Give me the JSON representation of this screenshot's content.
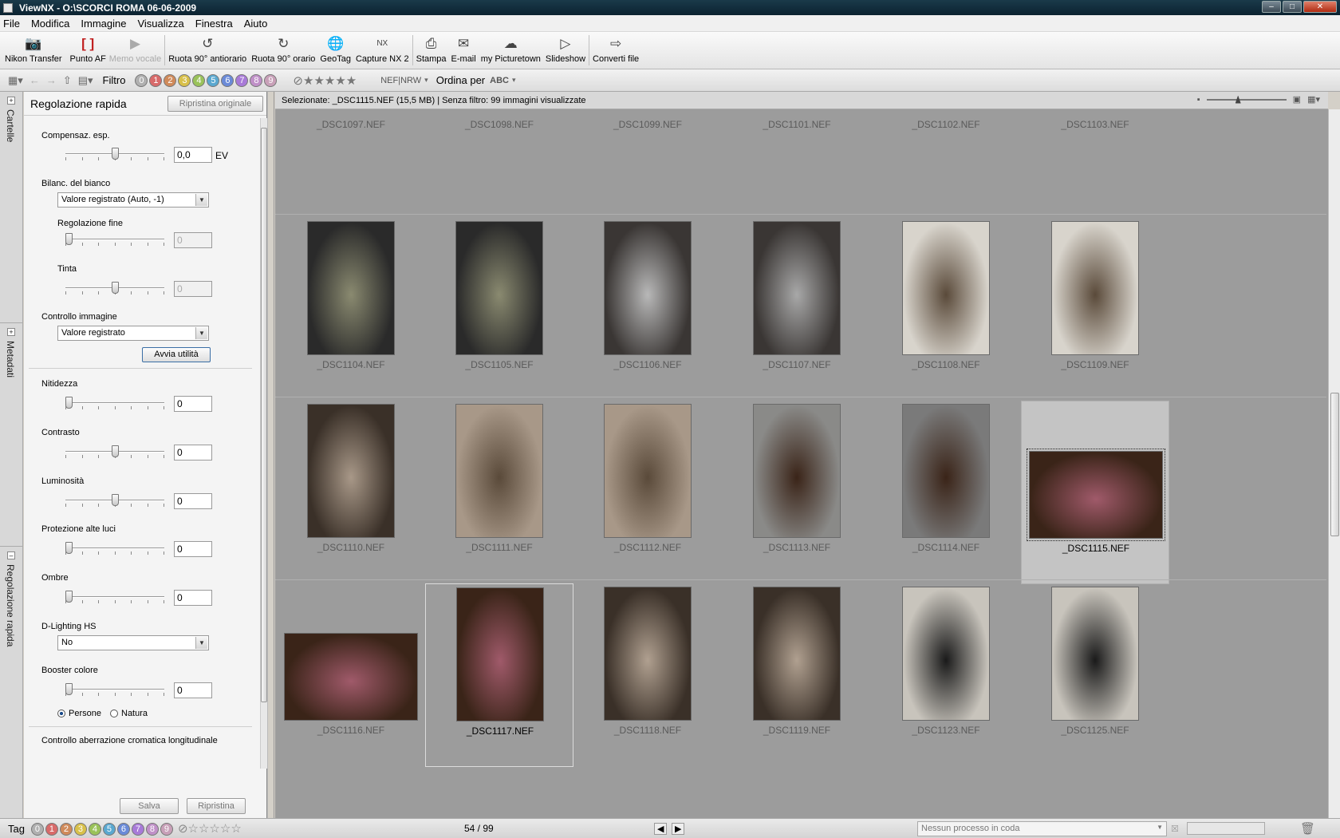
{
  "window": {
    "app": "ViewNX",
    "title": "ViewNX - O:\\SCORCI ROMA 06-06-2009"
  },
  "menu": [
    "File",
    "Modifica",
    "Immagine",
    "Visualizza",
    "Finestra",
    "Aiuto"
  ],
  "toolbar": {
    "items": [
      {
        "label": "Nikon Transfer",
        "icon": "camera-icon"
      },
      {
        "label": "Punto AF",
        "icon": "af-point-icon"
      },
      {
        "label": "Memo vocale",
        "icon": "voice-memo-icon",
        "disabled": true
      },
      {
        "label": "Ruota 90° antiorario",
        "icon": "rotate-ccw-icon"
      },
      {
        "label": "Ruota 90° orario",
        "icon": "rotate-cw-icon"
      },
      {
        "label": "GeoTag",
        "icon": "globe-icon"
      },
      {
        "label": "Capture NX 2",
        "icon": "capture-nx-icon"
      },
      {
        "label": "Stampa",
        "icon": "print-icon"
      },
      {
        "label": "E-mail",
        "icon": "mail-icon"
      },
      {
        "label": "my Picturetown",
        "icon": "picturetown-icon"
      },
      {
        "label": "Slideshow",
        "icon": "slideshow-icon"
      },
      {
        "label": "Converti file",
        "icon": "convert-icon"
      }
    ]
  },
  "filterbar": {
    "filter_label": "Filtro",
    "labels": [
      "0",
      "1",
      "2",
      "3",
      "4",
      "5",
      "6",
      "7",
      "8",
      "9"
    ],
    "label_colors": [
      "#b0b0b0",
      "#d86a6a",
      "#d08a5a",
      "#d8c04a",
      "#9ac25a",
      "#5aa8d0",
      "#6a8ad8",
      "#a87ad8",
      "#c090c8",
      "#c8a0b8"
    ],
    "format_toggle": "NEF|NRW",
    "sort_label": "Ordina per",
    "sort_icon": "ABC"
  },
  "sidetabs": [
    "Cartelle",
    "Metadati",
    "Regolazione rapida"
  ],
  "panel": {
    "title": "Regolazione rapida",
    "reset_original": "Ripristina originale",
    "exposure": {
      "label": "Compensaz. esp.",
      "value": "0,0",
      "unit": "EV",
      "position": 0.5
    },
    "wb": {
      "label": "Bilanc. del bianco",
      "value": "Valore registrato (Auto, -1)"
    },
    "fine_adjust": {
      "label": "Regolazione fine",
      "value": "0",
      "position": 0.0
    },
    "tint": {
      "label": "Tinta",
      "value": "0",
      "position": 0.5
    },
    "picture_control": {
      "label": "Controllo immagine",
      "value": "Valore registrato"
    },
    "launch_utility": "Avvia utilità",
    "sharpness": {
      "label": "Nitidezza",
      "value": "0",
      "position": 0.0
    },
    "contrast": {
      "label": "Contrasto",
      "value": "0",
      "position": 0.5
    },
    "brightness": {
      "label": "Luminosità",
      "value": "0",
      "position": 0.5
    },
    "highlight_protection": {
      "label": "Protezione alte luci",
      "value": "0",
      "position": 0.0
    },
    "shadows": {
      "label": "Ombre",
      "value": "0",
      "position": 0.0
    },
    "dlighting": {
      "label": "D-Lighting HS",
      "value": "No"
    },
    "color_booster": {
      "label": "Booster colore",
      "value": "0",
      "position": 0.0
    },
    "booster_options": [
      "Persone",
      "Natura"
    ],
    "booster_selected": "Persone",
    "chromatic": "Controllo aberrazione cromatica longitudinale",
    "save": "Salva",
    "restore": "Ripristina"
  },
  "browser": {
    "status": "Selezionate: _DSC1115.NEF (15,5 MB) | Senza filtro: 99 immagini visualizzate",
    "rows": [
      [
        {
          "name": "_DSC1097.NEF",
          "color": "#6a645c"
        },
        {
          "name": "_DSC1098.NEF",
          "color": "#6e6860"
        },
        {
          "name": "_DSC1099.NEF",
          "color": "#7a7468"
        },
        {
          "name": "_DSC1101.NEF",
          "color": "#3a3a3c"
        },
        {
          "name": "_DSC1102.NEF",
          "color": "#6a5a40"
        },
        {
          "name": "_DSC1103.NEF",
          "color": "#6a5a40"
        }
      ],
      [
        {
          "name": "_DSC1104.NEF",
          "color": "#2a2a2a",
          "accent": "#8a8a70",
          "orient": "portrait"
        },
        {
          "name": "_DSC1105.NEF",
          "color": "#2a2a2a",
          "accent": "#8a8a70",
          "orient": "portrait"
        },
        {
          "name": "_DSC1106.NEF",
          "color": "#3a3634",
          "accent": "#b8b8b8",
          "orient": "portrait"
        },
        {
          "name": "_DSC1107.NEF",
          "color": "#3a3634",
          "accent": "#a8a8a8",
          "orient": "portrait"
        },
        {
          "name": "_DSC1108.NEF",
          "color": "#d8d4cc",
          "accent": "#5a4a3a",
          "orient": "portrait"
        },
        {
          "name": "_DSC1109.NEF",
          "color": "#d8d4cc",
          "accent": "#5a4a3a",
          "orient": "portrait"
        }
      ],
      [
        {
          "name": "_DSC1110.NEF",
          "color": "#3a3028",
          "accent": "#a89888",
          "orient": "portrait"
        },
        {
          "name": "_DSC1111.NEF",
          "color": "#a89888",
          "accent": "#5a4a3a",
          "orient": "portrait"
        },
        {
          "name": "_DSC1112.NEF",
          "color": "#a89888",
          "accent": "#5a4a3a",
          "orient": "portrait"
        },
        {
          "name": "_DSC1113.NEF",
          "color": "#8a8a88",
          "accent": "#3a2418",
          "orient": "portrait"
        },
        {
          "name": "_DSC1114.NEF",
          "color": "#7a7a7a",
          "accent": "#3a2418",
          "orient": "portrait"
        },
        {
          "name": "_DSC1115.NEF",
          "color": "#3a2418",
          "accent": "#a05a6a",
          "orient": "landscape",
          "selected": true
        }
      ],
      [
        {
          "name": "_DSC1116.NEF",
          "color": "#3a2418",
          "accent": "#a05a6a",
          "orient": "landscape"
        },
        {
          "name": "_DSC1117.NEF",
          "color": "#3a2418",
          "accent": "#a05a6a",
          "orient": "portrait",
          "hover": true
        },
        {
          "name": "_DSC1118.NEF",
          "color": "#3a3028",
          "accent": "#b0a090",
          "orient": "portrait"
        },
        {
          "name": "_DSC1119.NEF",
          "color": "#3a3028",
          "accent": "#b0a090",
          "orient": "portrait"
        },
        {
          "name": "_DSC1123.NEF",
          "color": "#c8c4bc",
          "accent": "#1a1a1a",
          "orient": "portrait"
        },
        {
          "name": "_DSC1125.NEF",
          "color": "#c8c4bc",
          "accent": "#1a1a1a",
          "orient": "portrait"
        }
      ]
    ]
  },
  "bottom": {
    "tag_label": "Tag",
    "page": "54 / 99",
    "queue": "Nessun processo in coda"
  }
}
